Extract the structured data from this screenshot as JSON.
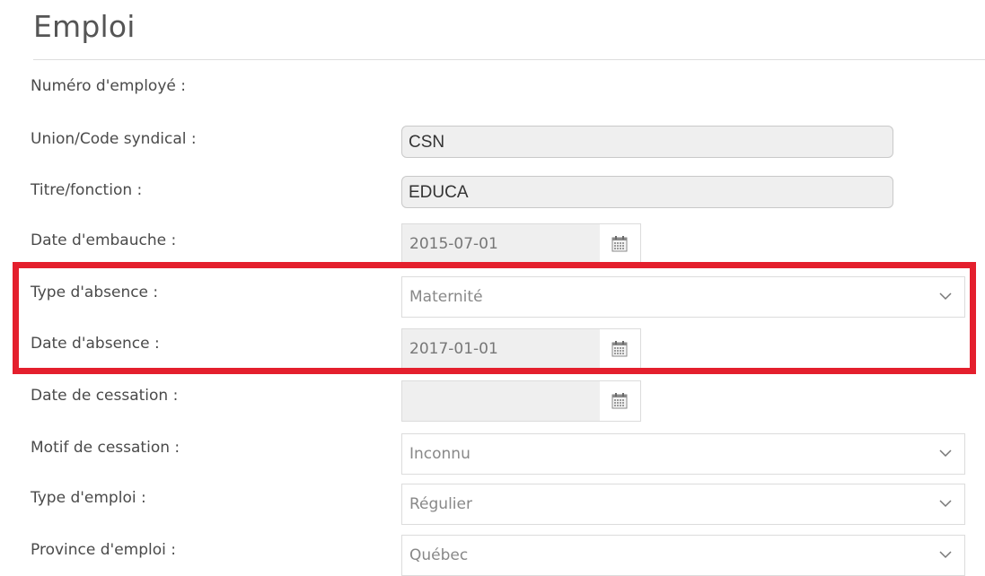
{
  "section": {
    "title": "Emploi"
  },
  "fields": {
    "employee_number": {
      "label": "Numéro d'employé :"
    },
    "union_code": {
      "label": "Union/Code syndical :",
      "value": "CSN"
    },
    "title_function": {
      "label": "Titre/fonction :",
      "value": "EDUCA"
    },
    "hire_date": {
      "label": "Date d'embauche :",
      "value": "2015-07-01"
    },
    "absence_type": {
      "label": "Type d'absence :",
      "value": "Maternité"
    },
    "absence_date": {
      "label": "Date d'absence :",
      "value": "2017-01-01"
    },
    "termination_date": {
      "label": "Date de cessation :",
      "value": ""
    },
    "termination_reason": {
      "label": "Motif de cessation :",
      "value": "Inconnu"
    },
    "employment_type": {
      "label": "Type d'emploi :",
      "value": "Régulier"
    },
    "employment_province": {
      "label": "Province d'emploi :",
      "value": "Québec"
    }
  },
  "icons": {
    "calendar": "calendar-icon",
    "dropdown": "chevron-down-icon"
  },
  "colors": {
    "highlight_border": "#e41f2d",
    "readonly_background": "#efefef"
  }
}
